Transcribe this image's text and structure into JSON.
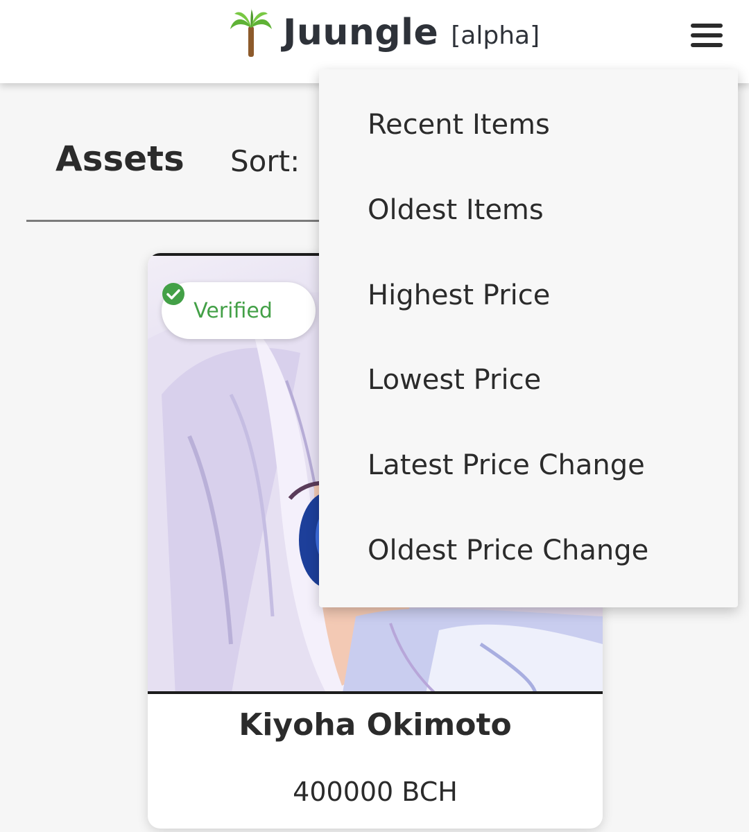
{
  "header": {
    "logo_icon": "palm-tree-icon",
    "brand_name": "Juungle",
    "brand_tag": "[alpha]",
    "menu_icon": "hamburger-menu-icon"
  },
  "assets": {
    "title": "Assets",
    "sort_label": "Sort:"
  },
  "sort_menu": {
    "items": [
      {
        "label": "Recent Items"
      },
      {
        "label": "Oldest Items"
      },
      {
        "label": "Highest Price"
      },
      {
        "label": "Lowest Price"
      },
      {
        "label": "Latest Price Change"
      },
      {
        "label": "Oldest Price Change"
      }
    ]
  },
  "card": {
    "badge": {
      "label": "Verified",
      "icon": "check-circle-icon",
      "color": "#43a047"
    },
    "name": "Kiyoha Okimoto",
    "price": "400000 BCH"
  },
  "colors": {
    "background": "#f6f6f6",
    "header": "#ffffff",
    "menu": "#f7f7f7",
    "text": "#2b2b2b",
    "verified_green": "#43a047"
  }
}
